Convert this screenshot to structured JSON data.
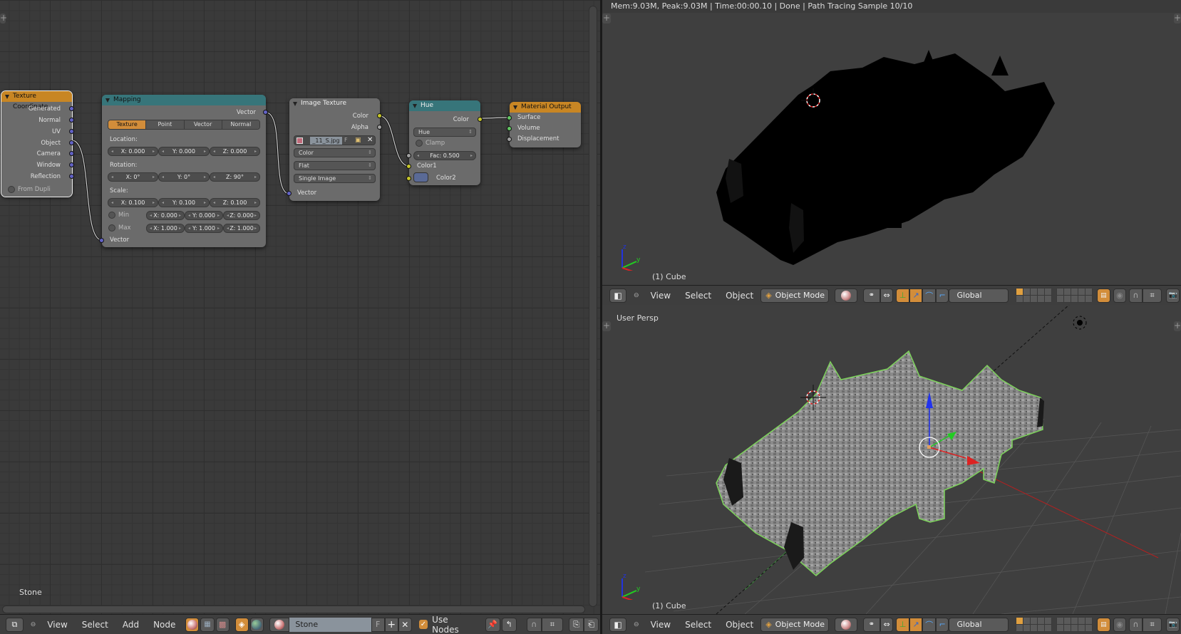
{
  "node_editor": {
    "material_name_overlay": "Stone",
    "nodes": {
      "texture_coordinate": {
        "title": "Texture Coordinate",
        "outputs": [
          "Generated",
          "Normal",
          "UV",
          "Object",
          "Camera",
          "Window",
          "Reflection"
        ],
        "from_dupli_label": "From Dupli"
      },
      "mapping": {
        "title": "Mapping",
        "output": "Vector",
        "type_tabs": [
          "Texture",
          "Point",
          "Vector",
          "Normal"
        ],
        "active_tab": "Texture",
        "location_label": "Location:",
        "location": [
          "X: 0.000",
          "Y: 0.000",
          "Z: 0.000"
        ],
        "rotation_label": "Rotation:",
        "rotation": [
          "X: 0°",
          "Y: 0°",
          "Z: 90°"
        ],
        "scale_label": "Scale:",
        "scale": [
          "X: 0.100",
          "Y: 0.100",
          "Z: 0.100"
        ],
        "min_label": "Min",
        "min": [
          "X: 0.000",
          "Y: 0.000",
          "Z: 0.000"
        ],
        "max_label": "Max",
        "max": [
          "X: 1.000",
          "Y: 1.000",
          "Z: 1.000"
        ],
        "input": "Vector"
      },
      "image_texture": {
        "title": "Image Texture",
        "outputs": [
          "Color",
          "Alpha"
        ],
        "image_name": "_11_S.jpg",
        "fake_user": "F",
        "color_space": "Color",
        "projection": "Flat",
        "source": "Single Image",
        "input": "Vector"
      },
      "hue": {
        "title": "Hue",
        "output": "Color",
        "blend_type": "Hue",
        "clamp_label": "Clamp",
        "fac": "Fac: 0.500",
        "color1_label": "Color1",
        "color2_label": "Color2",
        "color2_value": "#5a6a96"
      },
      "material_output": {
        "title": "Material Output",
        "inputs": [
          "Surface",
          "Volume",
          "Displacement"
        ]
      }
    }
  },
  "node_header": {
    "menus": [
      "View",
      "Select",
      "Add",
      "Node"
    ],
    "material_field": "Stone",
    "fake_user": "F",
    "use_nodes_label": "Use Nodes",
    "use_nodes_checked": true
  },
  "render_viewport": {
    "status_text": "Mem:9.03M, Peak:9.03M | Time:00:00.10 | Done | Path Tracing Sample 10/10",
    "object_label": "(1) Cube"
  },
  "solid_viewport": {
    "view_label": "User Persp",
    "object_label": "(1) Cube"
  },
  "view3d_header": {
    "menus": [
      "View",
      "Select",
      "Object"
    ],
    "mode": "Object Mode",
    "orientation": "Global"
  },
  "colors": {
    "accent": "#d28d3a",
    "input_node_header": "#c88624",
    "vector_node_header": "#37757a",
    "socket_vector": "#6363c7",
    "socket_color": "#c7c729",
    "socket_shader": "#63c763",
    "selection_outline": "#8fe07a"
  }
}
